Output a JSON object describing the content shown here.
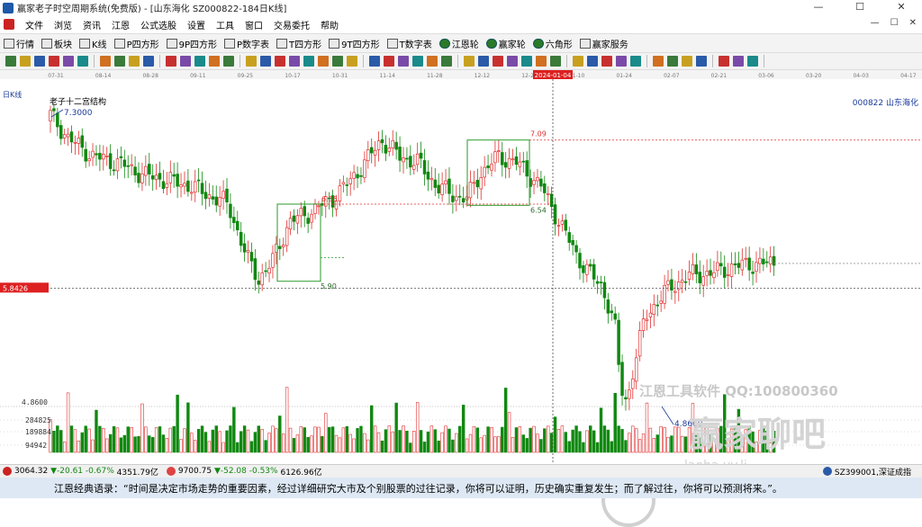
{
  "window": {
    "title": "赢家老子时空周期系统(免费版) - [山东海化  SZ000822-184日K线]",
    "minimize": "—",
    "maximize": "☐",
    "close": "✕"
  },
  "menu": {
    "items": [
      "文件",
      "浏览",
      "资讯",
      "江恩",
      "公式选股",
      "设置",
      "工具",
      "窗口",
      "交易委托",
      "帮助"
    ],
    "right": [
      "—",
      "☐",
      "✕"
    ]
  },
  "toolbar1": {
    "items": [
      "行情",
      "板块",
      "K线",
      "P四方形",
      "9P四方形",
      "P数字表",
      "T四方形",
      "9T四方形",
      "T数字表",
      "江恩轮",
      "赢家轮",
      "六角形",
      "赢家服务"
    ]
  },
  "chart": {
    "period_label": "日K线",
    "stock_label": "000822 山东海化",
    "structure_label": "老子十二宫结构",
    "date_ticks": [
      "07-31",
      "08-14",
      "08-28",
      "09-11",
      "09-25",
      "10-17",
      "10-31",
      "11-14",
      "11-28",
      "12-12",
      "12-26",
      "01-10",
      "01-24",
      "02-07",
      "02-21",
      "03-06",
      "03-20",
      "04-03",
      "04-17"
    ],
    "crosshair_date": "2024-01-04",
    "crosshair_price": "5.8426",
    "labels": {
      "high": "7.3000",
      "box1_top": "6.55",
      "box1_bottom": "5.90",
      "box2_top": "7.09",
      "box2_bottom": "6.54",
      "low": "4.8600",
      "axis_low": "4.8600"
    },
    "volume_ticks": [
      "284825",
      "189884",
      "94942"
    ],
    "colors": {
      "up": "#e03030",
      "down": "#118811",
      "box": "#2a9a2a",
      "dash_red": "#e03030",
      "crosshair": "#333333",
      "label_bg": "#dd2020"
    },
    "watermark": {
      "line1": "江恩工具软件  QQ:100800360",
      "brand": "赢家聊吧",
      "site": "laoba.yy.lj"
    }
  },
  "statusbar": {
    "index1_value": "3064.32",
    "index1_change": "▼-20.61",
    "index1_pct": "-0.67%",
    "index1_amount": "4351.79亿",
    "index2_value": "9700.75",
    "index2_change": "▼-52.08",
    "index2_pct": "-0.53%",
    "index2_amount": "6126.96亿",
    "right_label": "SZ399001,深证成指"
  },
  "quote": {
    "text": "江恩经典语录：“时间是决定市场走势的重要因素，经过详细研究大市及个别股票的过往记录，你将可以证明，历史确实重复发生；而了解过往，你将可以预测将来。”。"
  }
}
